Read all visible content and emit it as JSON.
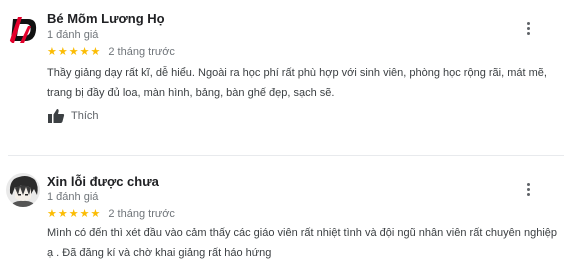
{
  "reviews": [
    {
      "author": "Bé Mõm Lương Họ",
      "review_count": "1 đánh giá",
      "stars": "★★★★★",
      "time_ago": "2 tháng trước",
      "text_lines": [
        "Thầy giảng dạy rất kĩ, dễ hiểu. Ngoài ra học phí rất phù hợp với sinh viên, phòng học rộng rãi, mát mẽ,",
        "trang bị đầy đủ loa, màn hình, bảng, bàn ghế đẹp, sạch sẽ."
      ],
      "like_label": "Thích",
      "avatar_icon": "red-d-logo-avatar"
    },
    {
      "author": "Xin lỗi được chưa",
      "review_count": "1 đánh giá",
      "stars": "★★★★★",
      "time_ago": "2 tháng trước",
      "text_lines": [
        "Mình có đến thì xét đầu vào cảm thấy các giáo viên rất nhiệt tình và đội ngũ nhân viên rất chuyên nghiệp",
        "ạ . Đã đăng kí và chờ khai giảng rất háo hứng"
      ],
      "avatar_icon": "anime-character-avatar"
    }
  ],
  "colors": {
    "star": "#fbbc04",
    "name": "#202124",
    "meta": "#70757a",
    "text": "#3c4043",
    "divider": "#e8eaed",
    "logo_red": "#e4002b"
  }
}
